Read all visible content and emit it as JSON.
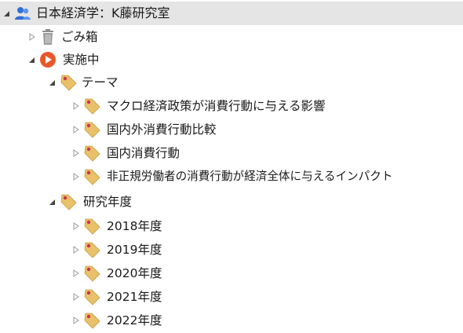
{
  "tree": {
    "root": {
      "label": "日本経済学：K藤研究室",
      "icon": "users-icon",
      "expanded": true
    },
    "trash": {
      "label": "ごみ箱",
      "icon": "trash-icon",
      "expanded": false
    },
    "active": {
      "label": "実施中",
      "icon": "play-circle-icon",
      "expanded": true
    },
    "theme": {
      "label": "テーマ",
      "icon": "tag-icon",
      "expanded": true,
      "items": [
        {
          "label": "マクロ経済政策が消費行動に与える影響",
          "icon": "tag-icon"
        },
        {
          "label": "国内外消費行動比較",
          "icon": "tag-icon"
        },
        {
          "label": "国内消費行動",
          "icon": "tag-icon"
        },
        {
          "label": "非正規労働者の消費行動が経済全体に与えるインパクト",
          "icon": "tag-icon"
        }
      ]
    },
    "year": {
      "label": "研究年度",
      "icon": "tag-icon",
      "expanded": true,
      "items": [
        {
          "label": "2018年度",
          "icon": "tag-icon"
        },
        {
          "label": "2019年度",
          "icon": "tag-icon"
        },
        {
          "label": "2020年度",
          "icon": "tag-icon"
        },
        {
          "label": "2021年度",
          "icon": "tag-icon"
        },
        {
          "label": "2022年度",
          "icon": "tag-icon"
        }
      ]
    }
  },
  "colors": {
    "selected_bg": "#e5e5e5",
    "tag_fill": "#e8c16a",
    "tag_dot": "#d0304a",
    "play": "#e8572a",
    "users": "#2f6fd6",
    "trash": "#8f8f8f"
  }
}
